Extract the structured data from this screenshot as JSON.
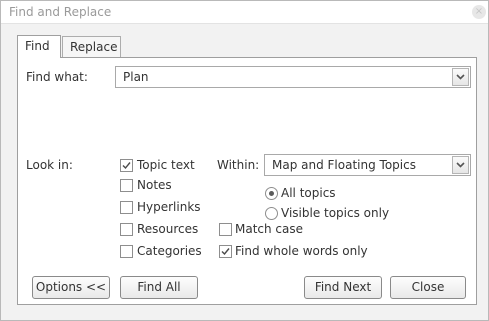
{
  "window": {
    "title": "Find and Replace",
    "close_glyph": "×"
  },
  "tabs": [
    {
      "label": "Find",
      "active": true
    },
    {
      "label": "Replace",
      "active": false
    }
  ],
  "find_what": {
    "label": "Find what:",
    "value": "Plan"
  },
  "look_in": {
    "label": "Look in:",
    "options": [
      {
        "label": "Topic text",
        "checked": true
      },
      {
        "label": "Notes",
        "checked": false
      },
      {
        "label": "Hyperlinks",
        "checked": false
      },
      {
        "label": "Resources",
        "checked": false
      },
      {
        "label": "Categories",
        "checked": false
      }
    ]
  },
  "within": {
    "label": "Within:",
    "value": "Map and Floating Topics",
    "radios": [
      {
        "label": "All topics",
        "selected": true
      },
      {
        "label": "Visible topics only",
        "selected": false
      }
    ]
  },
  "match_case": {
    "label": "Match case",
    "checked": false
  },
  "whole_words": {
    "label": "Find whole words only",
    "checked": true
  },
  "buttons": {
    "options": "Options <<",
    "find_all": "Find All",
    "find_next": "Find Next",
    "close": "Close"
  }
}
